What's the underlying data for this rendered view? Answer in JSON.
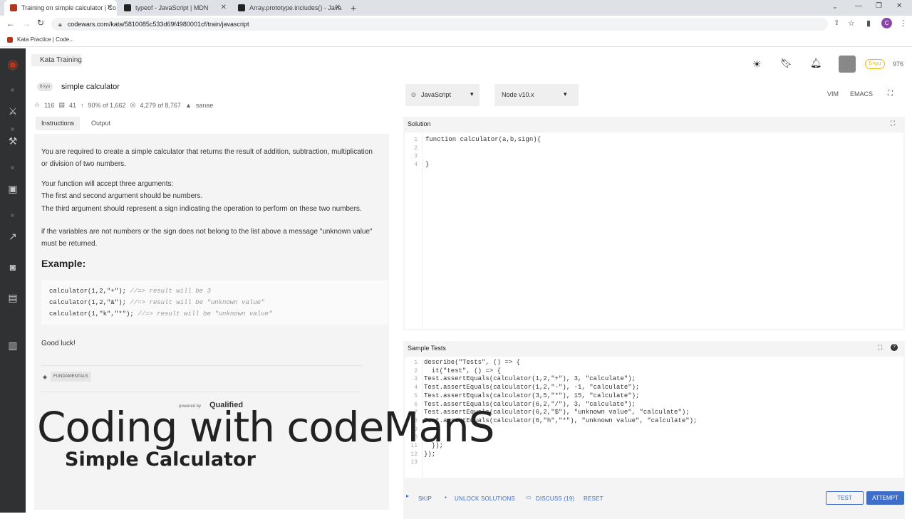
{
  "browser": {
    "tabs": [
      {
        "title": "Training on simple calculator | Co",
        "favicon_color": "#b1361e"
      },
      {
        "title": "typeof - JavaScript | MDN",
        "favicon_color": "#222222"
      },
      {
        "title": "Array.prototype.includes() - Java",
        "favicon_color": "#222222"
      }
    ],
    "url": "codewars.com/kata/5810085c533d69f4980001cf/train/javascript",
    "bookmark": "Kata Practice | Code...",
    "profile_initial": "C"
  },
  "header": {
    "breadcrumb": "Kata Training",
    "rank": "5 kyu",
    "honor": "976"
  },
  "kata": {
    "kyu": "8 kyu",
    "title": "simple calculator",
    "stars": "116",
    "collections": "41",
    "satisfaction": "90% of 1,662",
    "completions": "4,279 of 8,767",
    "author": "sanae",
    "tabs": [
      "Instructions",
      "Output"
    ],
    "p1": "You are required to create a simple calculator that returns the result of addition, subtraction, multiplication or division of two numbers.",
    "p2a": "Your function will accept three arguments:",
    "p2b": "The first and second argument should be numbers.",
    "p2c": "The third argument should represent a sign indicating the operation to perform on these two numbers.",
    "p3": "if the variables are not numbers or the sign does not belong to the list above a message \"unknown value\" must be returned.",
    "example_heading": "Example:",
    "example_lines": [
      {
        "code": "calculator(1,2,\"+\");",
        "comment": " //=> result will be 3"
      },
      {
        "code": "calculator(1,2,\"&\");",
        "comment": " //=> result will be \"unknown value\""
      },
      {
        "code": "calculator(1,\"k\",\"*\");",
        "comment": " //=> result will be \"unknown value\""
      }
    ],
    "good_luck": "Good luck!",
    "tag": "FUNDAMENTALS",
    "powered_by": "powered by",
    "qualified": "Qualified"
  },
  "editor": {
    "language": "JavaScript",
    "version": "Node v10.x",
    "mode_vim": "VIM",
    "mode_emacs": "EMACS",
    "solution_title": "Solution",
    "solution_lines": [
      "function calculator(a,b,sign){",
      "",
      "",
      "}"
    ],
    "tests_title": "Sample Tests",
    "test_lines": [
      "describe(\"Tests\", () => {",
      "  it(\"test\", () => {",
      "Test.assertEquals(calculator(1,2,\"+\"), 3, \"calculate\");",
      "Test.assertEquals(calculator(1,2,\"-\"), -1, \"calculate\");",
      "Test.assertEquals(calculator(3,5,\"*\"), 15, \"calculate\");",
      "Test.assertEquals(calculator(6,2,\"/\"), 3, \"calculate\");",
      "Test.assertEquals(calculator(6,2,\"$\"), \"unknown value\", \"calculate\");",
      "Test.assertEquals(calculator(6,\"h\",\"*\"), \"unknown value\", \"calculate\");",
      "",
      "",
      "  });",
      "});",
      ""
    ]
  },
  "actions": {
    "skip": "SKIP",
    "unlock": "UNLOCK SOLUTIONS",
    "discuss": "DISCUSS (19)",
    "reset": "RESET",
    "test": "TEST",
    "attempt": "ATTEMPT"
  },
  "overlay": {
    "title": "Coding with codeManS",
    "subtitle": "Simple Calculator"
  }
}
